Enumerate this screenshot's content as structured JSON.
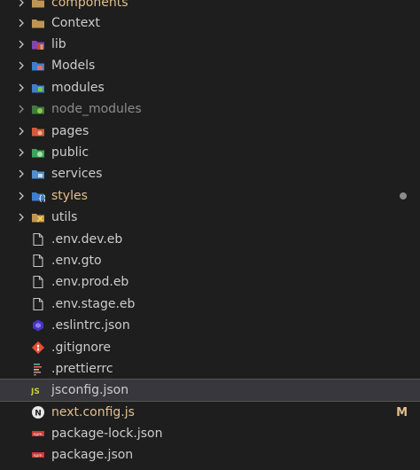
{
  "explorer": {
    "folders": [
      {
        "label": "components",
        "icon": "folder-icon",
        "color": "#e2c08d"
      },
      {
        "label": "Context",
        "icon": "folder-icon"
      },
      {
        "label": "lib",
        "icon": "lib-folder-icon"
      },
      {
        "label": "Models",
        "icon": "models-folder-icon"
      },
      {
        "label": "modules",
        "icon": "modules-folder-icon"
      },
      {
        "label": "node_modules",
        "icon": "node-modules-folder-icon",
        "dimmed": true
      },
      {
        "label": "pages",
        "icon": "pages-folder-icon"
      },
      {
        "label": "public",
        "icon": "public-folder-icon"
      },
      {
        "label": "services",
        "icon": "services-folder-icon"
      },
      {
        "label": "styles",
        "icon": "styles-folder-icon",
        "color": "#e2c08d",
        "modified_dot": true
      },
      {
        "label": "utils",
        "icon": "utils-folder-icon"
      }
    ],
    "files": [
      {
        "label": ".env.dev.eb",
        "icon": "file-icon"
      },
      {
        "label": ".env.gto",
        "icon": "file-icon"
      },
      {
        "label": ".env.prod.eb",
        "icon": "file-icon"
      },
      {
        "label": ".env.stage.eb",
        "icon": "file-icon"
      },
      {
        "label": ".eslintrc.json",
        "icon": "eslint-icon"
      },
      {
        "label": ".gitignore",
        "icon": "git-icon"
      },
      {
        "label": ".prettierrc",
        "icon": "prettier-icon"
      },
      {
        "label": "jsconfig.json",
        "icon": "js-icon",
        "selected": true
      },
      {
        "label": "next.config.js",
        "icon": "nextjs-icon",
        "color": "#e2c08d",
        "badge": "M"
      },
      {
        "label": "package-lock.json",
        "icon": "npm-icon"
      },
      {
        "label": "package.json",
        "icon": "npm-icon"
      }
    ]
  }
}
